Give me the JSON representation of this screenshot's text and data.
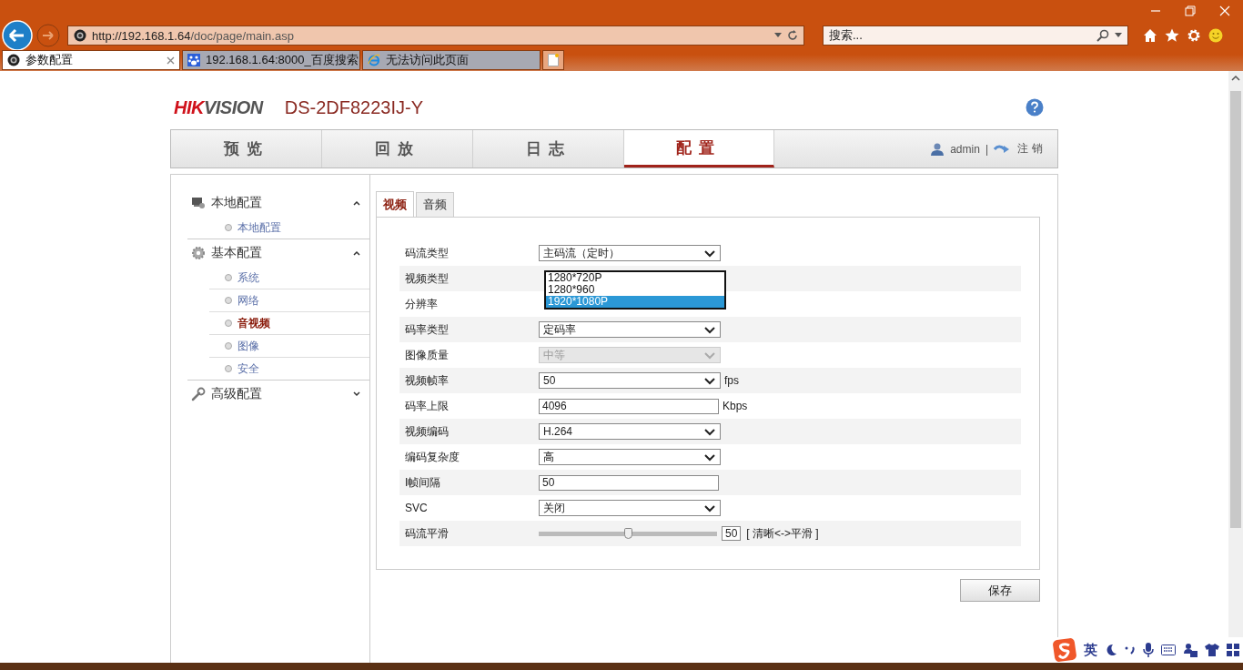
{
  "browser": {
    "address_host": "http://192.168.1.64",
    "address_path": "/doc/page/main.asp",
    "search_placeholder": "搜索...",
    "tabs": [
      {
        "title": "参数配置",
        "selected": true
      },
      {
        "title": "192.168.1.64:8000_百度搜索",
        "selected": false
      },
      {
        "title": "无法访问此页面",
        "selected": false
      }
    ]
  },
  "header": {
    "logo_parts": [
      "HIK",
      "VISION"
    ],
    "model": "DS-2DF8223IJ-Y"
  },
  "nav": {
    "tabs": [
      {
        "label": "预览",
        "selected": false
      },
      {
        "label": "回放",
        "selected": false
      },
      {
        "label": "日志",
        "selected": false
      },
      {
        "label": "配置",
        "selected": true
      }
    ],
    "user": "admin",
    "separator": "|",
    "logout": "注销"
  },
  "sidebar": [
    {
      "title": "本地配置",
      "expanded": true,
      "children": [
        {
          "label": "本地配置",
          "selected": false
        }
      ]
    },
    {
      "title": "基本配置",
      "expanded": true,
      "children": [
        {
          "label": "系统",
          "selected": false
        },
        {
          "label": "网络",
          "selected": false
        },
        {
          "label": "音视频",
          "selected": true
        },
        {
          "label": "图像",
          "selected": false
        },
        {
          "label": "安全",
          "selected": false
        }
      ]
    },
    {
      "title": "高级配置",
      "expanded": false
    }
  ],
  "subtabs": [
    {
      "label": "视频",
      "selected": true
    },
    {
      "label": "音频",
      "selected": false
    }
  ],
  "form": [
    {
      "kind": "select",
      "label": "码流类型",
      "value": "主码流（定时）",
      "disabled": false
    },
    {
      "kind": "covered",
      "label": "视频类型"
    },
    {
      "kind": "covered",
      "label": "分辨率"
    },
    {
      "kind": "select",
      "label": "码率类型",
      "value": "定码率",
      "disabled": false
    },
    {
      "kind": "select",
      "label": "图像质量",
      "value": "中等",
      "disabled": true
    },
    {
      "kind": "select",
      "label": "视频帧率",
      "value": "50",
      "disabled": false,
      "unit": "fps"
    },
    {
      "kind": "input",
      "label": "码率上限",
      "value": "4096",
      "unit": "Kbps"
    },
    {
      "kind": "select",
      "label": "视频编码",
      "value": "H.264",
      "disabled": false
    },
    {
      "kind": "select",
      "label": "编码复杂度",
      "value": "高",
      "disabled": false
    },
    {
      "kind": "input",
      "label": "I帧间隔",
      "value": "50"
    },
    {
      "kind": "select",
      "label": "SVC",
      "value": "关闭",
      "disabled": false
    },
    {
      "kind": "slider",
      "label": "码流平滑",
      "level": 0.5,
      "value": "50",
      "hint": "[ 清晰<->平滑 ]"
    }
  ],
  "open_dropdown": {
    "options": [
      {
        "label": "1280*720P",
        "selected": false
      },
      {
        "label": "1280*960",
        "selected": false
      },
      {
        "label": "1920*1080P",
        "selected": true
      }
    ]
  },
  "save_button": "保存",
  "ime": {
    "mode": "英"
  }
}
